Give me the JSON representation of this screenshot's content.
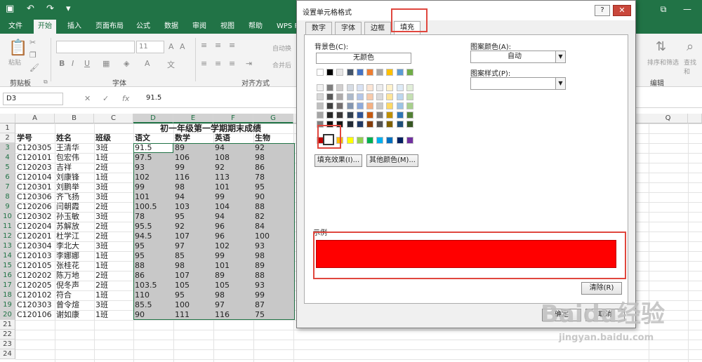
{
  "titlebar": {
    "undo": "↶",
    "redo": "↷",
    "more": "▾",
    "ribbon_display": "⧉",
    "minimize": "—",
    "restore": "❐"
  },
  "ribbon_tabs": [
    "文件",
    "开始",
    "插入",
    "页面布局",
    "公式",
    "数据",
    "审阅",
    "视图",
    "帮助",
    "WPS P"
  ],
  "ribbon": {
    "paste": "粘贴",
    "clipboard_group": "剪贴板",
    "font_group": "字体",
    "align_group": "对齐方式",
    "edit_group": "编辑",
    "font_size": "11",
    "bold": "B",
    "italic": "I",
    "underline": "U",
    "wrap_text": "自动换",
    "merge": "合并后",
    "sort_filter": "排序和筛选",
    "find_select": "查找和"
  },
  "formula_bar": {
    "name_box": "D3",
    "cancel": "✕",
    "enter": "✓",
    "fx": "fx",
    "value": "91.5"
  },
  "columns": [
    "A",
    "B",
    "C",
    "D",
    "E",
    "F",
    "G",
    "Q"
  ],
  "rows": [
    "1",
    "2",
    "3",
    "4",
    "5",
    "6",
    "7",
    "8",
    "9",
    "10",
    "11",
    "12",
    "13",
    "14",
    "15",
    "16",
    "17",
    "18",
    "19",
    "20",
    "21",
    "22",
    "23",
    "24"
  ],
  "sheet": {
    "title": "初一年级第一学期期末成绩",
    "headers": [
      "学号",
      "姓名",
      "班级",
      "语文",
      "数学",
      "英语",
      "生物"
    ],
    "data": [
      [
        "C120305",
        "王清华",
        "3班",
        "91.5",
        "89",
        "94",
        "92"
      ],
      [
        "C120101",
        "包宏伟",
        "1班",
        "97.5",
        "106",
        "108",
        "98"
      ],
      [
        "C120203",
        "吉祥",
        "2班",
        "93",
        "99",
        "92",
        "86"
      ],
      [
        "C120104",
        "刘康锋",
        "1班",
        "102",
        "116",
        "113",
        "78"
      ],
      [
        "C120301",
        "刘鹏举",
        "3班",
        "99",
        "98",
        "101",
        "95"
      ],
      [
        "C120306",
        "齐飞扬",
        "3班",
        "101",
        "94",
        "99",
        "90"
      ],
      [
        "C120206",
        "闫朝霞",
        "2班",
        "100.5",
        "103",
        "104",
        "88"
      ],
      [
        "C120302",
        "孙玉敏",
        "3班",
        "78",
        "95",
        "94",
        "82"
      ],
      [
        "C120204",
        "苏解放",
        "2班",
        "95.5",
        "92",
        "96",
        "84"
      ],
      [
        "C120201",
        "杜学江",
        "2班",
        "94.5",
        "107",
        "96",
        "100"
      ],
      [
        "C120304",
        "李北大",
        "3班",
        "95",
        "97",
        "102",
        "93"
      ],
      [
        "C120103",
        "李娜娜",
        "1班",
        "95",
        "85",
        "99",
        "98"
      ],
      [
        "C120105",
        "张桂花",
        "1班",
        "88",
        "98",
        "101",
        "89"
      ],
      [
        "C120202",
        "陈万地",
        "2班",
        "86",
        "107",
        "89",
        "88"
      ],
      [
        "C120205",
        "倪冬声",
        "2班",
        "103.5",
        "105",
        "105",
        "93"
      ],
      [
        "C120102",
        "符合",
        "1班",
        "110",
        "95",
        "98",
        "99"
      ],
      [
        "C120303",
        "曾令煊",
        "3班",
        "85.5",
        "100",
        "97",
        "87"
      ],
      [
        "C120106",
        "谢如康",
        "1班",
        "90",
        "111",
        "116",
        "75"
      ]
    ]
  },
  "dialog": {
    "title": "设置单元格格式",
    "help": "?",
    "close": "✕",
    "tabs": [
      "数字",
      "字体",
      "边框",
      "填充"
    ],
    "bg_color_label": "背景色(C):",
    "no_color": "无颜色",
    "pattern_color_label": "图案颜色(A):",
    "pattern_color_value": "自动",
    "pattern_style_label": "图案样式(P):",
    "fill_effects": "填充效果(I)...",
    "more_colors": "其他颜色(M)...",
    "sample_label": "示例",
    "sample_color": "#ff0000",
    "clear": "清除(R)",
    "ok": "确定",
    "cancel": "取消"
  },
  "palette": {
    "theme_top": [
      "#ffffff",
      "#000000",
      "#e7e6e6",
      "#44546a",
      "#4472c4",
      "#ed7d31",
      "#a5a5a5",
      "#ffc000",
      "#5b9bd5",
      "#70ad47"
    ],
    "theme_shades": [
      [
        "#f2f2f2",
        "#7f7f7f",
        "#d0cece",
        "#d6dce4",
        "#d9e2f3",
        "#fbe5d5",
        "#ededed",
        "#fff2cc",
        "#deebf6",
        "#e2efd9"
      ],
      [
        "#d8d8d8",
        "#595959",
        "#aeabab",
        "#adb9ca",
        "#b4c6e7",
        "#f7cbac",
        "#dbdbdb",
        "#fee599",
        "#bdd7ee",
        "#c5e0b3"
      ],
      [
        "#bfbfbf",
        "#3f3f3f",
        "#757070",
        "#8496b0",
        "#8eaadb",
        "#f4b183",
        "#c9c9c9",
        "#ffd965",
        "#9cc3e5",
        "#a8d08d"
      ],
      [
        "#a5a5a5",
        "#262626",
        "#3a3838",
        "#323f4f",
        "#2f5496",
        "#c55a11",
        "#7b7b7b",
        "#bf9000",
        "#2e75b5",
        "#538135"
      ],
      [
        "#7f7f7f",
        "#0c0c0c",
        "#171616",
        "#222a35",
        "#1f3864",
        "#833c0b",
        "#525252",
        "#7f6000",
        "#1e4e79",
        "#375623"
      ]
    ],
    "standard": [
      "#c00000",
      "#ff0000",
      "#ffc000",
      "#ffff00",
      "#92d050",
      "#00b050",
      "#00b0f0",
      "#0070c0",
      "#002060",
      "#7030a0"
    ]
  },
  "watermark": {
    "brand": "Baidu经验",
    "url": "jingyan.baidu.com"
  }
}
